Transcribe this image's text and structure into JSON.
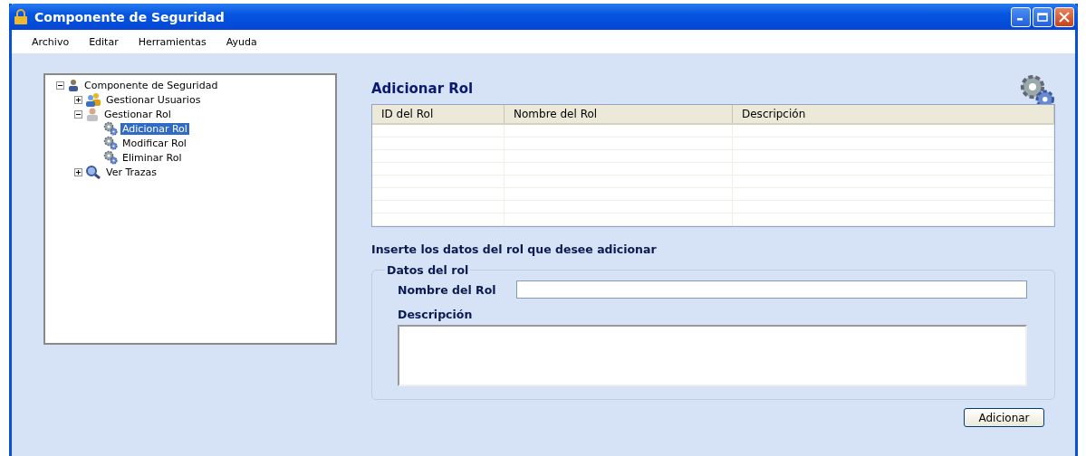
{
  "window": {
    "title": "Componente de Seguridad"
  },
  "menu": [
    "Archivo",
    "Editar",
    "Herramientas",
    "Ayuda"
  ],
  "tree": [
    {
      "label": "Componente de Seguridad",
      "kind": "root",
      "expanded": true,
      "selected": false,
      "children": [
        {
          "label": "Gestionar Usuarios",
          "kind": "users",
          "expanded": false,
          "selected": false
        },
        {
          "label": "Gestionar Rol",
          "kind": "role",
          "expanded": true,
          "selected": false,
          "children": [
            {
              "label": "Adicionar Rol",
              "kind": "action",
              "selected": true
            },
            {
              "label": "Modificar Rol",
              "kind": "action",
              "selected": false
            },
            {
              "label": "Eliminar Rol",
              "kind": "action",
              "selected": false
            }
          ]
        },
        {
          "label": "Ver Trazas",
          "kind": "trace",
          "expanded": false,
          "selected": false
        }
      ]
    }
  ],
  "page_title": "Adicionar Rol",
  "table": {
    "columns": [
      "ID del Rol",
      "Nombre del Rol",
      "Descripción"
    ]
  },
  "instruction": "Inserte los datos del rol que desee adicionar",
  "group": {
    "title": "Datos del rol",
    "name_label": "Nombre del Rol",
    "description_label": "Descripción"
  },
  "buttons": [
    "Adicionar"
  ]
}
